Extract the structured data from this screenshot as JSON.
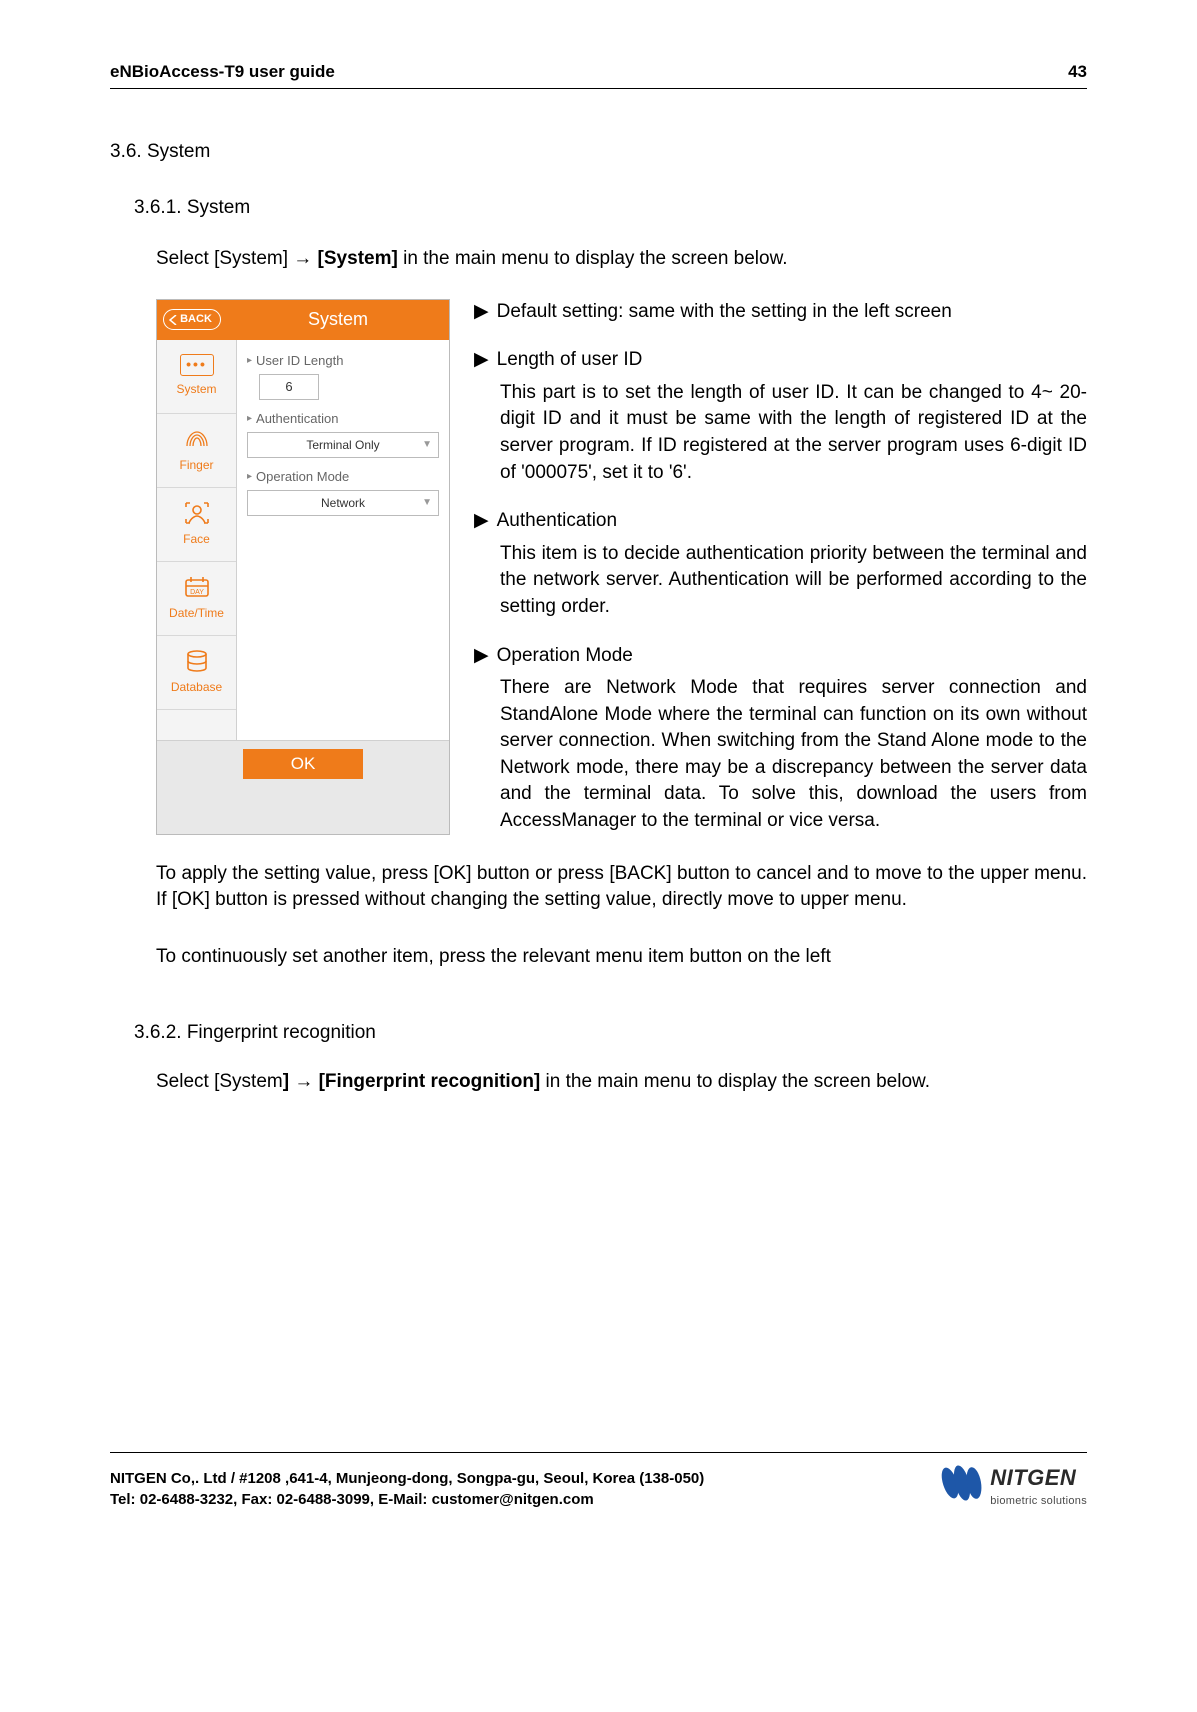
{
  "header": {
    "title": "eNBioAccess-T9 user guide",
    "page": "43"
  },
  "s36": {
    "heading": "3.6. System"
  },
  "s361": {
    "heading": "3.6.1. System",
    "instr_pre": "Select [System] ",
    "instr_arrow": "→",
    "instr_bold": " [System]",
    "instr_post": " in the main menu to display the screen below."
  },
  "device": {
    "back": "BACK",
    "title": "System",
    "sidebar": [
      {
        "label": "System"
      },
      {
        "label": "Finger"
      },
      {
        "label": "Face"
      },
      {
        "label": "Date/Time"
      },
      {
        "label": "Database"
      }
    ],
    "fields": {
      "uid_label": "User ID Length",
      "uid_value": "6",
      "auth_label": "Authentication",
      "auth_value": "Terminal Only",
      "op_label": "Operation Mode",
      "op_value": "Network"
    },
    "ok": "OK"
  },
  "bullets": {
    "b1": "Default setting: same with the setting in the left screen",
    "b2_head": "Length of user ID",
    "b2_body": "This part is to set the length of user ID. It can be changed to 4~ 20-digit ID and it must be same with the length of registered ID at the server program. If ID registered at the server program uses 6-digit ID of '000075', set it to '6'.",
    "b3_head": "Authentication",
    "b3_body": "This item is to decide authentication priority between the terminal and the network server. Authentication will be performed according to the setting order.",
    "b4_head": "Operation Mode",
    "b4_body": "There are Network Mode that requires server connection and StandAlone Mode where the terminal can function on its own without server connection. When switching from the Stand Alone mode to the Network mode, there may be a discrepancy between the server data and the terminal data. To solve this, download the users from AccessManager to the terminal or vice versa."
  },
  "after1_a": "To apply the setting value, press [OK",
  "after1_b": "] button or press [BACK] button to cancel and to move to the upper menu. If [OK] button is pressed without changing the setting value, directly move to upper menu.",
  "after2": "To continuously set another item, press the relevant menu item button on the left",
  "s362": {
    "heading": "3.6.2. Fingerprint recognition",
    "instr_pre": "Select [System",
    "instr_mid": "] ",
    "instr_arrow": "→",
    "instr_bold2": " [Fingerprint recognition]",
    "instr_post": " in the main menu to display the screen below."
  },
  "footer": {
    "line1": "NITGEN Co,. Ltd / #1208 ,641-4, Munjeong-dong, Songpa-gu, Seoul, Korea (138-050)",
    "line2": "Tel: 02-6488-3232, Fax: 02-6488-3099, E-Mail: customer@nitgen.com",
    "logo_name": "NITGEN",
    "logo_sub": "biometric solutions"
  }
}
